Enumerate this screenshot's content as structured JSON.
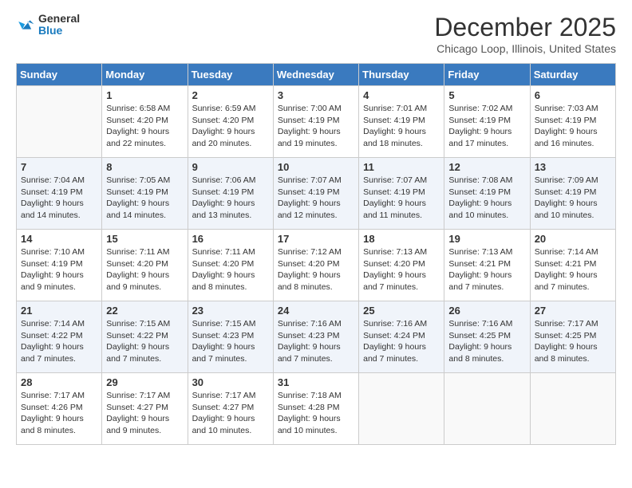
{
  "header": {
    "logo": {
      "general": "General",
      "blue": "Blue"
    },
    "title": "December 2025",
    "location": "Chicago Loop, Illinois, United States"
  },
  "days_of_week": [
    "Sunday",
    "Monday",
    "Tuesday",
    "Wednesday",
    "Thursday",
    "Friday",
    "Saturday"
  ],
  "weeks": [
    [
      {
        "day": "",
        "info": ""
      },
      {
        "day": "1",
        "info": "Sunrise: 6:58 AM\nSunset: 4:20 PM\nDaylight: 9 hours\nand 22 minutes."
      },
      {
        "day": "2",
        "info": "Sunrise: 6:59 AM\nSunset: 4:20 PM\nDaylight: 9 hours\nand 20 minutes."
      },
      {
        "day": "3",
        "info": "Sunrise: 7:00 AM\nSunset: 4:19 PM\nDaylight: 9 hours\nand 19 minutes."
      },
      {
        "day": "4",
        "info": "Sunrise: 7:01 AM\nSunset: 4:19 PM\nDaylight: 9 hours\nand 18 minutes."
      },
      {
        "day": "5",
        "info": "Sunrise: 7:02 AM\nSunset: 4:19 PM\nDaylight: 9 hours\nand 17 minutes."
      },
      {
        "day": "6",
        "info": "Sunrise: 7:03 AM\nSunset: 4:19 PM\nDaylight: 9 hours\nand 16 minutes."
      }
    ],
    [
      {
        "day": "7",
        "info": "Sunrise: 7:04 AM\nSunset: 4:19 PM\nDaylight: 9 hours\nand 14 minutes."
      },
      {
        "day": "8",
        "info": "Sunrise: 7:05 AM\nSunset: 4:19 PM\nDaylight: 9 hours\nand 14 minutes."
      },
      {
        "day": "9",
        "info": "Sunrise: 7:06 AM\nSunset: 4:19 PM\nDaylight: 9 hours\nand 13 minutes."
      },
      {
        "day": "10",
        "info": "Sunrise: 7:07 AM\nSunset: 4:19 PM\nDaylight: 9 hours\nand 12 minutes."
      },
      {
        "day": "11",
        "info": "Sunrise: 7:07 AM\nSunset: 4:19 PM\nDaylight: 9 hours\nand 11 minutes."
      },
      {
        "day": "12",
        "info": "Sunrise: 7:08 AM\nSunset: 4:19 PM\nDaylight: 9 hours\nand 10 minutes."
      },
      {
        "day": "13",
        "info": "Sunrise: 7:09 AM\nSunset: 4:19 PM\nDaylight: 9 hours\nand 10 minutes."
      }
    ],
    [
      {
        "day": "14",
        "info": "Sunrise: 7:10 AM\nSunset: 4:19 PM\nDaylight: 9 hours\nand 9 minutes."
      },
      {
        "day": "15",
        "info": "Sunrise: 7:11 AM\nSunset: 4:20 PM\nDaylight: 9 hours\nand 9 minutes."
      },
      {
        "day": "16",
        "info": "Sunrise: 7:11 AM\nSunset: 4:20 PM\nDaylight: 9 hours\nand 8 minutes."
      },
      {
        "day": "17",
        "info": "Sunrise: 7:12 AM\nSunset: 4:20 PM\nDaylight: 9 hours\nand 8 minutes."
      },
      {
        "day": "18",
        "info": "Sunrise: 7:13 AM\nSunset: 4:20 PM\nDaylight: 9 hours\nand 7 minutes."
      },
      {
        "day": "19",
        "info": "Sunrise: 7:13 AM\nSunset: 4:21 PM\nDaylight: 9 hours\nand 7 minutes."
      },
      {
        "day": "20",
        "info": "Sunrise: 7:14 AM\nSunset: 4:21 PM\nDaylight: 9 hours\nand 7 minutes."
      }
    ],
    [
      {
        "day": "21",
        "info": "Sunrise: 7:14 AM\nSunset: 4:22 PM\nDaylight: 9 hours\nand 7 minutes."
      },
      {
        "day": "22",
        "info": "Sunrise: 7:15 AM\nSunset: 4:22 PM\nDaylight: 9 hours\nand 7 minutes."
      },
      {
        "day": "23",
        "info": "Sunrise: 7:15 AM\nSunset: 4:23 PM\nDaylight: 9 hours\nand 7 minutes."
      },
      {
        "day": "24",
        "info": "Sunrise: 7:16 AM\nSunset: 4:23 PM\nDaylight: 9 hours\nand 7 minutes."
      },
      {
        "day": "25",
        "info": "Sunrise: 7:16 AM\nSunset: 4:24 PM\nDaylight: 9 hours\nand 7 minutes."
      },
      {
        "day": "26",
        "info": "Sunrise: 7:16 AM\nSunset: 4:25 PM\nDaylight: 9 hours\nand 8 minutes."
      },
      {
        "day": "27",
        "info": "Sunrise: 7:17 AM\nSunset: 4:25 PM\nDaylight: 9 hours\nand 8 minutes."
      }
    ],
    [
      {
        "day": "28",
        "info": "Sunrise: 7:17 AM\nSunset: 4:26 PM\nDaylight: 9 hours\nand 8 minutes."
      },
      {
        "day": "29",
        "info": "Sunrise: 7:17 AM\nSunset: 4:27 PM\nDaylight: 9 hours\nand 9 minutes."
      },
      {
        "day": "30",
        "info": "Sunrise: 7:17 AM\nSunset: 4:27 PM\nDaylight: 9 hours\nand 10 minutes."
      },
      {
        "day": "31",
        "info": "Sunrise: 7:18 AM\nSunset: 4:28 PM\nDaylight: 9 hours\nand 10 minutes."
      },
      {
        "day": "",
        "info": ""
      },
      {
        "day": "",
        "info": ""
      },
      {
        "day": "",
        "info": ""
      }
    ]
  ]
}
